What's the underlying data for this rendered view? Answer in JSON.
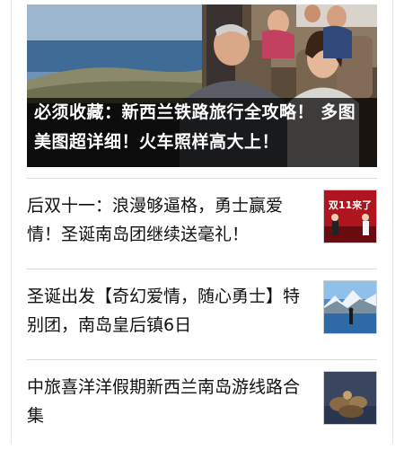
{
  "featured": {
    "title": "必须收藏：新西兰铁路旅行全攻略！ 多图美图超详细！火车照样高大上！"
  },
  "articles": [
    {
      "title": "后双十一：浪漫够逼格，勇士赢爱情！圣诞南岛团继续送毫礼！",
      "thumb_text": "双11来了"
    },
    {
      "title": "圣诞出发【奇幻爱情，随心勇士】特别团，南岛皇后镇6日"
    },
    {
      "title": "中旅喜洋洋假期新西兰南岛游线路合集"
    }
  ]
}
